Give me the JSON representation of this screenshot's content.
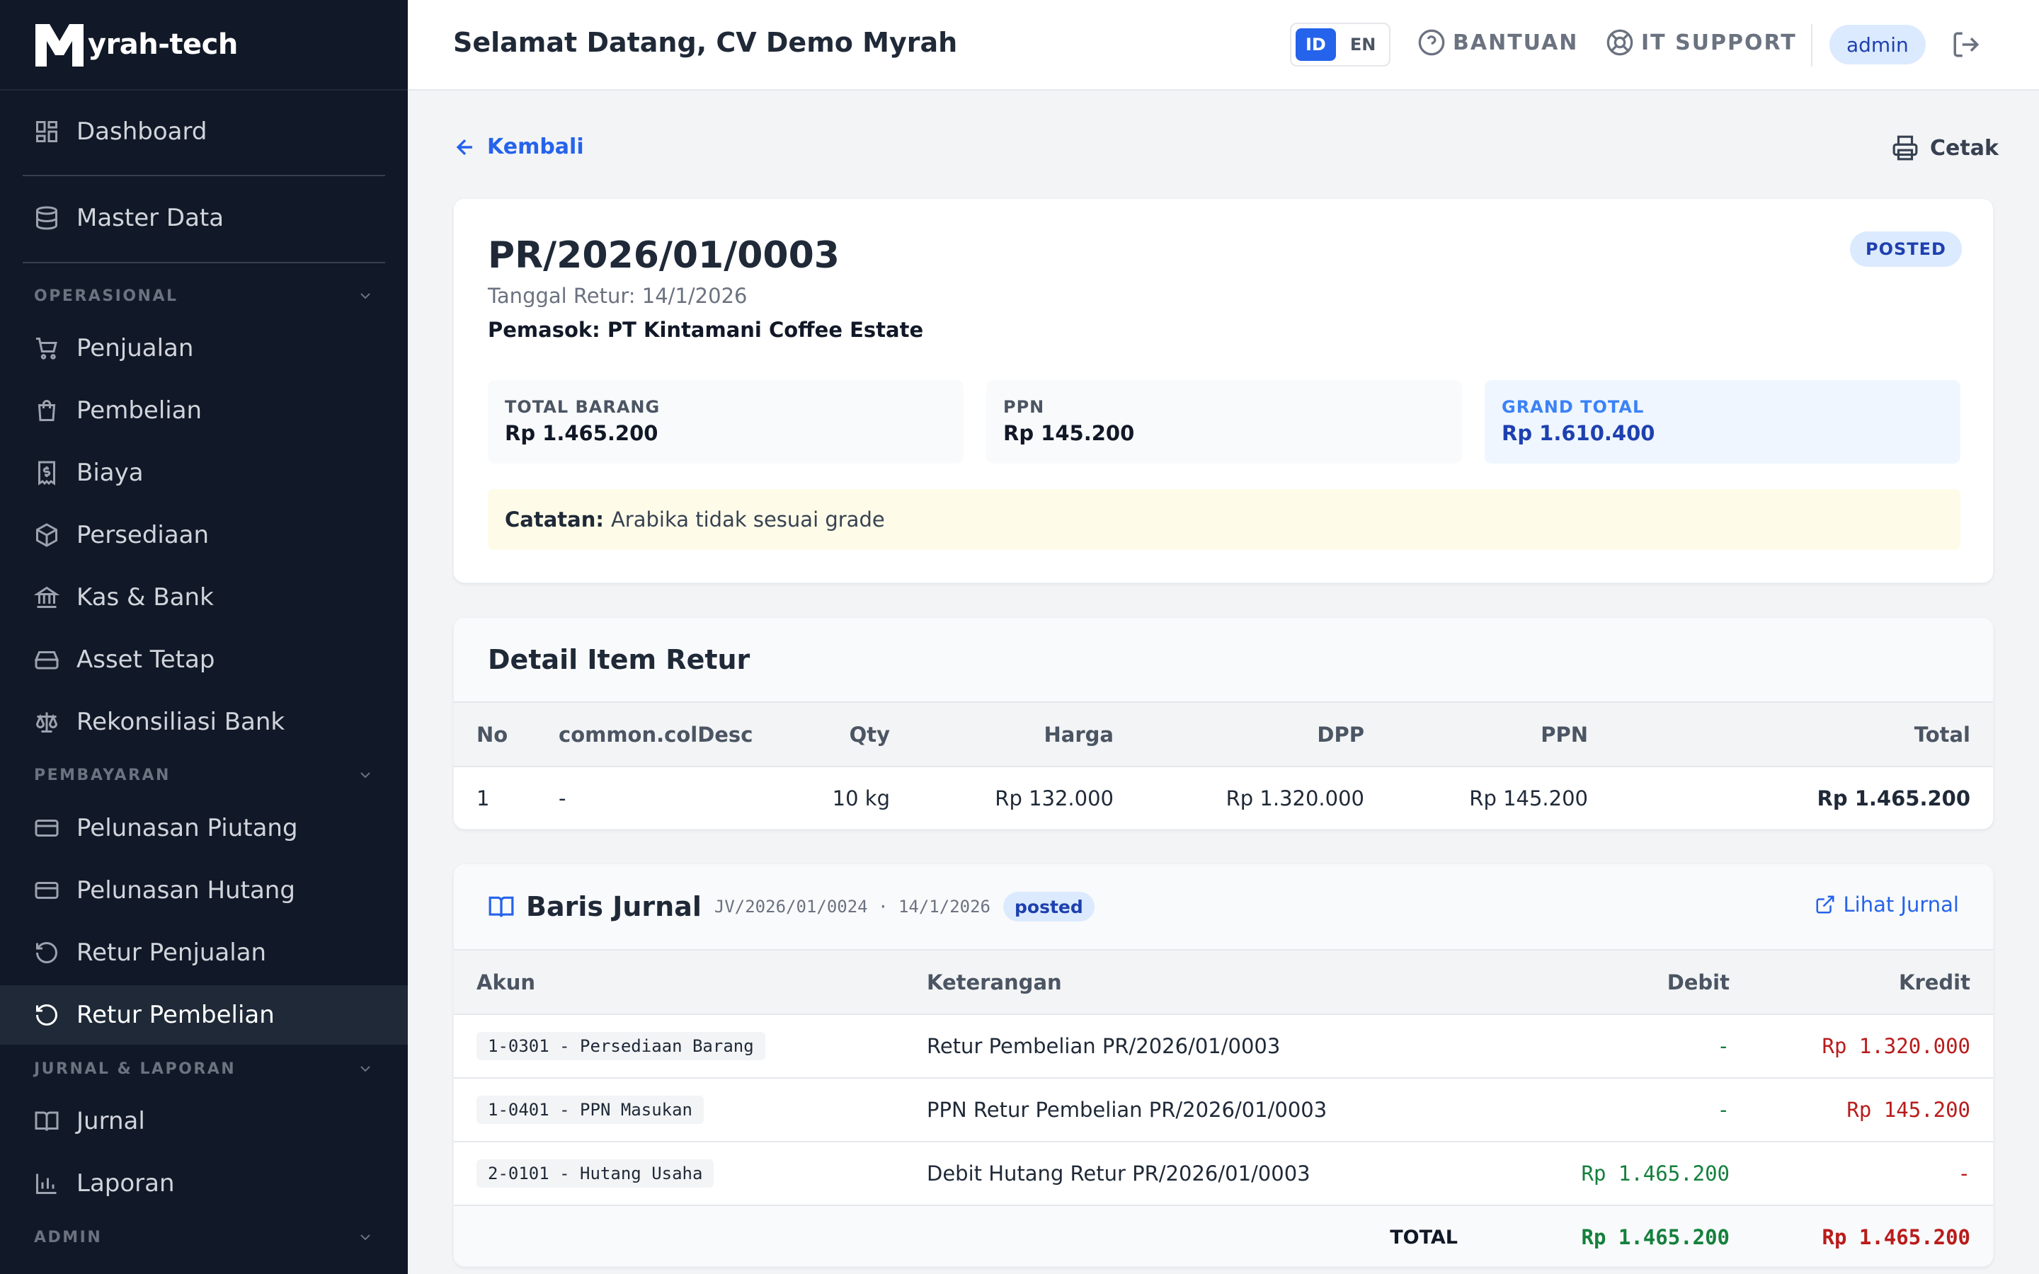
{
  "brand": {
    "name": "yrah-tech"
  },
  "sidebar": {
    "items": [
      {
        "label": "Dashboard",
        "icon": "dashboard-icon"
      },
      {
        "label": "Master Data",
        "icon": "database-icon"
      },
      {
        "label": "Penjualan",
        "icon": "cart-icon"
      },
      {
        "label": "Pembelian",
        "icon": "shopping-bag-icon"
      },
      {
        "label": "Biaya",
        "icon": "receipt-dollar-icon"
      },
      {
        "label": "Persediaan",
        "icon": "package-icon"
      },
      {
        "label": "Kas & Bank",
        "icon": "bank-icon"
      },
      {
        "label": "Asset Tetap",
        "icon": "hard-drive-icon"
      },
      {
        "label": "Rekonsiliasi Bank",
        "icon": "scale-icon"
      },
      {
        "label": "Pelunasan Piutang",
        "icon": "credit-card-icon"
      },
      {
        "label": "Pelunasan Hutang",
        "icon": "credit-card-icon"
      },
      {
        "label": "Retur Penjualan",
        "icon": "rotate-ccw-icon"
      },
      {
        "label": "Retur Pembelian",
        "icon": "rotate-ccw-icon"
      },
      {
        "label": "Jurnal",
        "icon": "book-open-icon"
      },
      {
        "label": "Laporan",
        "icon": "bar-chart-icon"
      }
    ],
    "sections": [
      "OPERASIONAL",
      "PEMBAYARAN",
      "JURNAL & LAPORAN",
      "ADMIN"
    ],
    "active": "Retur Pembelian"
  },
  "header": {
    "title": "Selamat Datang, CV Demo Myrah",
    "lang": [
      "ID",
      "EN"
    ],
    "lang_active": "ID",
    "help": "BANTUAN",
    "support": "IT SUPPORT",
    "user": "admin"
  },
  "actions": {
    "back": "Kembali",
    "print": "Cetak"
  },
  "doc": {
    "number": "PR/2026/01/0003",
    "date_line": "Tanggal Retur: 14/1/2026",
    "supplier_line": "Pemasok: PT Kintamani Coffee Estate",
    "status": "POSTED",
    "summary": {
      "total_label": "TOTAL BARANG",
      "total_value": "Rp 1.465.200",
      "ppn_label": "PPN",
      "ppn_value": "Rp 145.200",
      "grand_label": "GRAND TOTAL",
      "grand_value": "Rp 1.610.400"
    },
    "note_label": "Catatan:",
    "note_text": "Arabika tidak sesuai grade"
  },
  "items": {
    "title": "Detail Item Retur",
    "headers": [
      "No",
      "common.colDesc",
      "Qty",
      "Harga",
      "DPP",
      "PPN",
      "Total"
    ],
    "rows": [
      [
        "1",
        "-",
        "10 kg",
        "Rp 132.000",
        "Rp 1.320.000",
        "Rp 145.200",
        "Rp 1.465.200"
      ]
    ]
  },
  "journal": {
    "title": "Baris Jurnal",
    "meta": "JV/2026/01/0024 · 14/1/2026",
    "status": "posted",
    "link": "Lihat Jurnal",
    "headers": [
      "Akun",
      "Keterangan",
      "Debit",
      "Kredit"
    ],
    "rows": [
      [
        "1-0301 - Persediaan Barang",
        "Retur Pembelian PR/2026/01/0003",
        "-",
        "Rp 1.320.000"
      ],
      [
        "1-0401 - PPN Masukan",
        "PPN Retur Pembelian PR/2026/01/0003",
        "-",
        "Rp 145.200"
      ],
      [
        "2-0101 - Hutang Usaha",
        "Debit Hutang Retur PR/2026/01/0003",
        "Rp 1.465.200",
        "-"
      ]
    ],
    "total_label": "TOTAL",
    "total_debit": "Rp 1.465.200",
    "total_credit": "Rp 1.465.200"
  },
  "colors": {
    "sidebar_bg": "#111827",
    "accent": "#2563eb",
    "debit": "#15803d",
    "credit": "#b91c1c"
  }
}
